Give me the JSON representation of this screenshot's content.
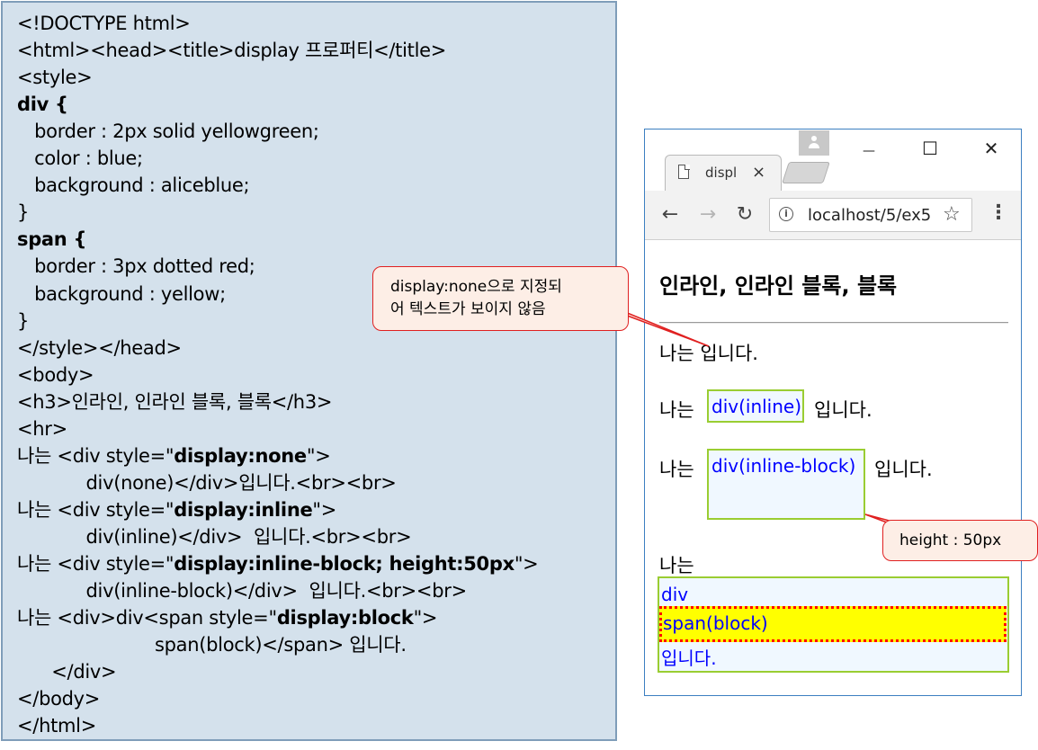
{
  "code": {
    "lines": [
      [
        {
          "t": "<!DOCTYPE html>"
        }
      ],
      [
        {
          "t": "<html><head><title>display 프로퍼티</title>"
        }
      ],
      [
        {
          "t": "<style>"
        }
      ],
      [
        {
          "t": "div {",
          "b": true
        }
      ],
      [
        {
          "t": "   border : 2px solid yellowgreen;"
        }
      ],
      [
        {
          "t": "   color : blue;"
        }
      ],
      [
        {
          "t": "   background : aliceblue;"
        }
      ],
      [
        {
          "t": "}"
        }
      ],
      [
        {
          "t": "span {",
          "b": true
        }
      ],
      [
        {
          "t": "   border : 3px dotted red;"
        }
      ],
      [
        {
          "t": "   background : yellow;"
        }
      ],
      [
        {
          "t": "}"
        }
      ],
      [
        {
          "t": "</style></head>"
        }
      ],
      [
        {
          "t": "<body>"
        }
      ],
      [
        {
          "t": "<h3>인라인, 인라인 블록, 블록</h3>"
        }
      ],
      [
        {
          "t": "<hr>"
        }
      ],
      [
        {
          "t": "나는 <div style=\""
        },
        {
          "t": "display:none",
          "b": true
        },
        {
          "t": "\">"
        }
      ],
      [
        {
          "t": "            div(none)</div>입니다.<br><br>"
        }
      ],
      [
        {
          "t": "나는 <div style=\""
        },
        {
          "t": "display:inline",
          "b": true
        },
        {
          "t": "\">"
        }
      ],
      [
        {
          "t": "            div(inline)</div>  입니다.<br><br>"
        }
      ],
      [
        {
          "t": "나는 <div style=\""
        },
        {
          "t": "display:inline-block; height:50px",
          "b": true
        },
        {
          "t": "\">"
        }
      ],
      [
        {
          "t": "            div(inline-block)</div>  입니다.<br><br>"
        }
      ],
      [
        {
          "t": "나는 <div>div<span style=\""
        },
        {
          "t": "display:block",
          "b": true
        },
        {
          "t": "\">"
        }
      ],
      [
        {
          "t": "                        span(block)</span> 입니다."
        }
      ],
      [
        {
          "t": "      </div>"
        }
      ],
      [
        {
          "t": "</body>"
        }
      ],
      [
        {
          "t": "</html>"
        }
      ]
    ]
  },
  "browser": {
    "tab_title": "displ",
    "tab_close": "×",
    "url": "localhost/5/ex5",
    "window_minimize": "—",
    "window_maximize": "☐",
    "window_close": "✕",
    "nav_back": "←",
    "nav_forward": "→",
    "nav_reload": "↻",
    "info": "i",
    "star": "☆",
    "menu": "⋮"
  },
  "page": {
    "heading": "인라인, 인라인 블록, 블록",
    "line1": "나는 입니다.",
    "line2_prefix": "나는",
    "line2_div": "div(inline)",
    "line2_suffix": "입니다.",
    "line3_prefix": "나는",
    "line3_div": "div(inline-block)",
    "line3_suffix": "입니다.",
    "line4_prefix": "나는",
    "block_div_text": "div",
    "block_span_text": "span(block)",
    "block_after_text": "입니다."
  },
  "callouts": {
    "none_note": [
      "display:none으로 지정되",
      "어 텍스트가 보이지 않음"
    ],
    "height_note": "height : 50px"
  },
  "colors": {
    "code_bg": "#d4e1ec",
    "div_border": "#9acd32",
    "div_text": "#0000ff",
    "div_bg": "#f0f8ff",
    "span_border": "#ff0000",
    "span_bg": "#ffff00",
    "callout_bg": "#fdeee6",
    "callout_border": "#e02020"
  }
}
